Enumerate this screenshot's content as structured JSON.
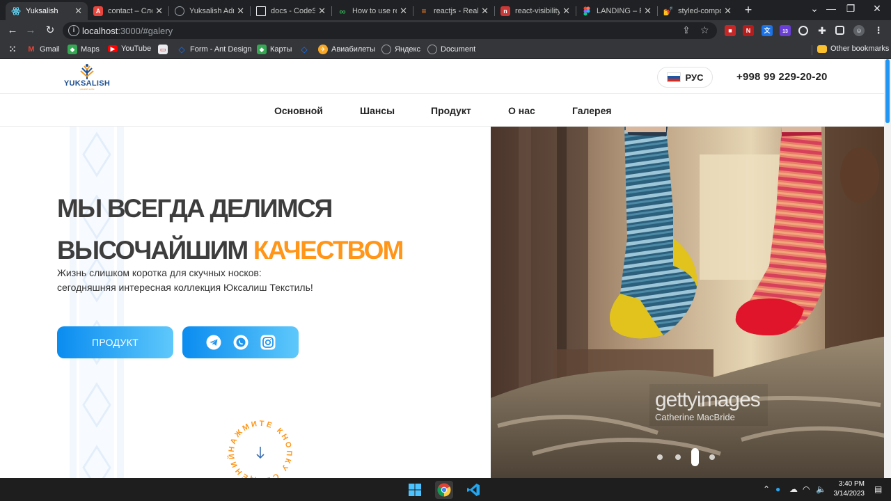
{
  "browser": {
    "tabs": [
      {
        "title": "Yuksalish",
        "favicon": "react-icon",
        "color": "#61dafb",
        "active": true
      },
      {
        "title": "contact – Слоя",
        "favicon": "app-icon",
        "color": "#e8453c"
      },
      {
        "title": "Yuksalish Adm",
        "favicon": "globe-icon",
        "color": "#9aa0a6"
      },
      {
        "title": "docs - CodeSa",
        "favicon": "page-icon",
        "color": "#e8eaed"
      },
      {
        "title": "How to use re",
        "favicon": "infinity-icon",
        "color": "#34a853"
      },
      {
        "title": "reactjs - Reakt",
        "favicon": "stack-icon",
        "color": "#f48024"
      },
      {
        "title": "react-visibility",
        "favicon": "npm-icon",
        "color": "#cb3837"
      },
      {
        "title": "LANDING – Fi",
        "favicon": "figma-icon",
        "color": "#a259ff"
      },
      {
        "title": "styled-compo",
        "favicon": "styled-icon",
        "color": "#61dafb"
      }
    ],
    "new_tab": "+",
    "url_host": "localhost",
    "url_path": ":3000/#galery",
    "bookmarks": [
      {
        "label": "Gmail",
        "icon": "gmail-icon",
        "color": "#ea4335"
      },
      {
        "label": "Maps",
        "icon": "maps-icon",
        "color": "#34a853"
      },
      {
        "label": "YouTube",
        "icon": "youtube-icon",
        "color": "#ff0000"
      },
      {
        "label": "",
        "icon": "folder-app-icon",
        "color": "#e8eaed"
      },
      {
        "label": "Form - Ant Design",
        "icon": "ant-design-icon",
        "color": "#1677ff"
      },
      {
        "label": "Карты",
        "icon": "maps-icon",
        "color": "#34a853"
      },
      {
        "label": "",
        "icon": "ant-design-icon",
        "color": "#1677ff"
      },
      {
        "label": "Авиабилеты",
        "icon": "plane-icon",
        "color": "#f9a825"
      },
      {
        "label": "Яндекс",
        "icon": "globe-icon",
        "color": "#9aa0a6"
      },
      {
        "label": "Document",
        "icon": "globe-icon",
        "color": "#9aa0a6"
      }
    ],
    "other_bookmarks": "Other bookmarks",
    "extension_badge": "13"
  },
  "site": {
    "brand": "YUKSALISH",
    "brand_tagline": "yuksalish textile",
    "language": "РУС",
    "phone": "+998 99 229-20-20",
    "nav": [
      "Основной",
      "Шансы",
      "Продукт",
      "О нас",
      "Галерея"
    ],
    "hero": {
      "headline_line1": "МЫ ВСЕГДА ДЕЛИМСЯ",
      "headline_line2_plain": "ВЫСОЧАЙШИМ ",
      "headline_line2_accent": "КАЧЕСТВОМ",
      "subtext": "Жизнь слишком коротка для скучных носков: сегодняшняя интересная коллекция Юксалиш Текстиль!",
      "product_button": "ПРОДУКТ",
      "scroll_badge_text": "НАЖМИТЕ КНОПКУ СВЕДЕНИЙ ",
      "accent_color": "#ff9619"
    },
    "slider": {
      "watermark": "gettyimages",
      "watermark_credit": "Catherine MacBride",
      "slide_count": 4,
      "active_slide": 3
    }
  },
  "taskbar": {
    "time": "3:40 PM",
    "date": "3/14/2023"
  }
}
